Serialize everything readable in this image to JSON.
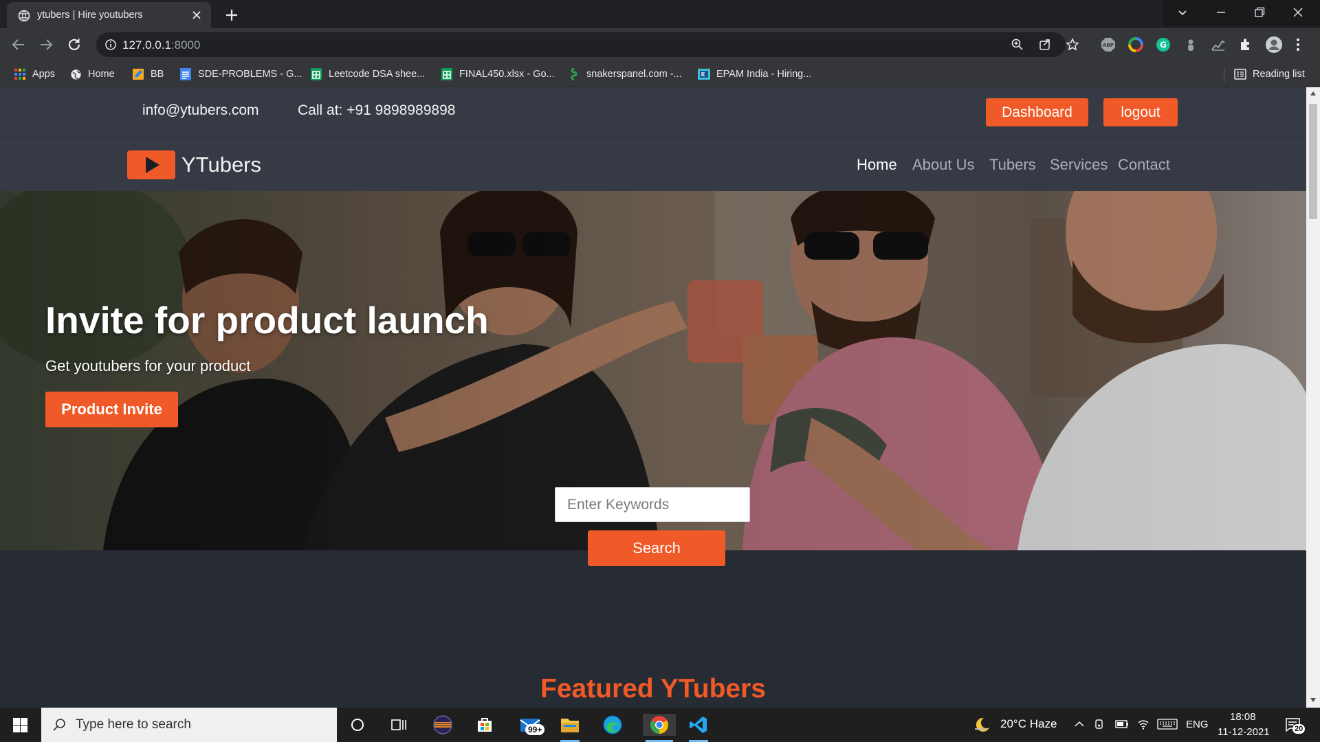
{
  "browser": {
    "tab_title": "ytubers | Hire youtubers",
    "url_host": "127.0.0.1",
    "url_port": ":8000",
    "reading_list": "Reading list",
    "bookmarks": [
      {
        "label": "Apps",
        "icon": "apps-grid-icon"
      },
      {
        "label": "Home",
        "icon": "globe-icon"
      },
      {
        "label": "BB",
        "icon": "pencil-note-icon"
      },
      {
        "label": "SDE-PROBLEMS - G...",
        "icon": "google-docs-icon"
      },
      {
        "label": "Leetcode DSA shee...",
        "icon": "google-sheets-icon"
      },
      {
        "label": "FINAL450.xlsx - Go...",
        "icon": "google-sheets-icon"
      },
      {
        "label": "snakerspanel.com -...",
        "icon": "snake-icon"
      },
      {
        "label": "EPAM India - Hiring...",
        "icon": "epam-icon"
      }
    ]
  },
  "topbar": {
    "email": "info@ytubers.com",
    "phone": "Call at: +91 9898989898",
    "dashboard_label": "Dashboard",
    "logout_label": "logout"
  },
  "nav": {
    "logo_text": "YTubers",
    "links": [
      "Home",
      "About Us",
      "Tubers",
      "Services",
      "Contact"
    ],
    "active": "Home"
  },
  "hero": {
    "title": "Invite for product launch",
    "subtitle": "Get youtubers for your product",
    "button_label": "Product Invite"
  },
  "search": {
    "placeholder": "Enter Keywords",
    "button_label": "Search"
  },
  "featured": {
    "heading": "Featured YTubers"
  },
  "taskbar": {
    "search_placeholder": "Type here to search",
    "mail_badge": "99+",
    "weather": "20°C  Haze",
    "language": "ENG",
    "time": "18:08",
    "date": "11-12-2021",
    "notification_count": "20"
  },
  "colors": {
    "accent": "#f05a28",
    "header_bg": "#363a45",
    "page_bg": "#272b33"
  }
}
